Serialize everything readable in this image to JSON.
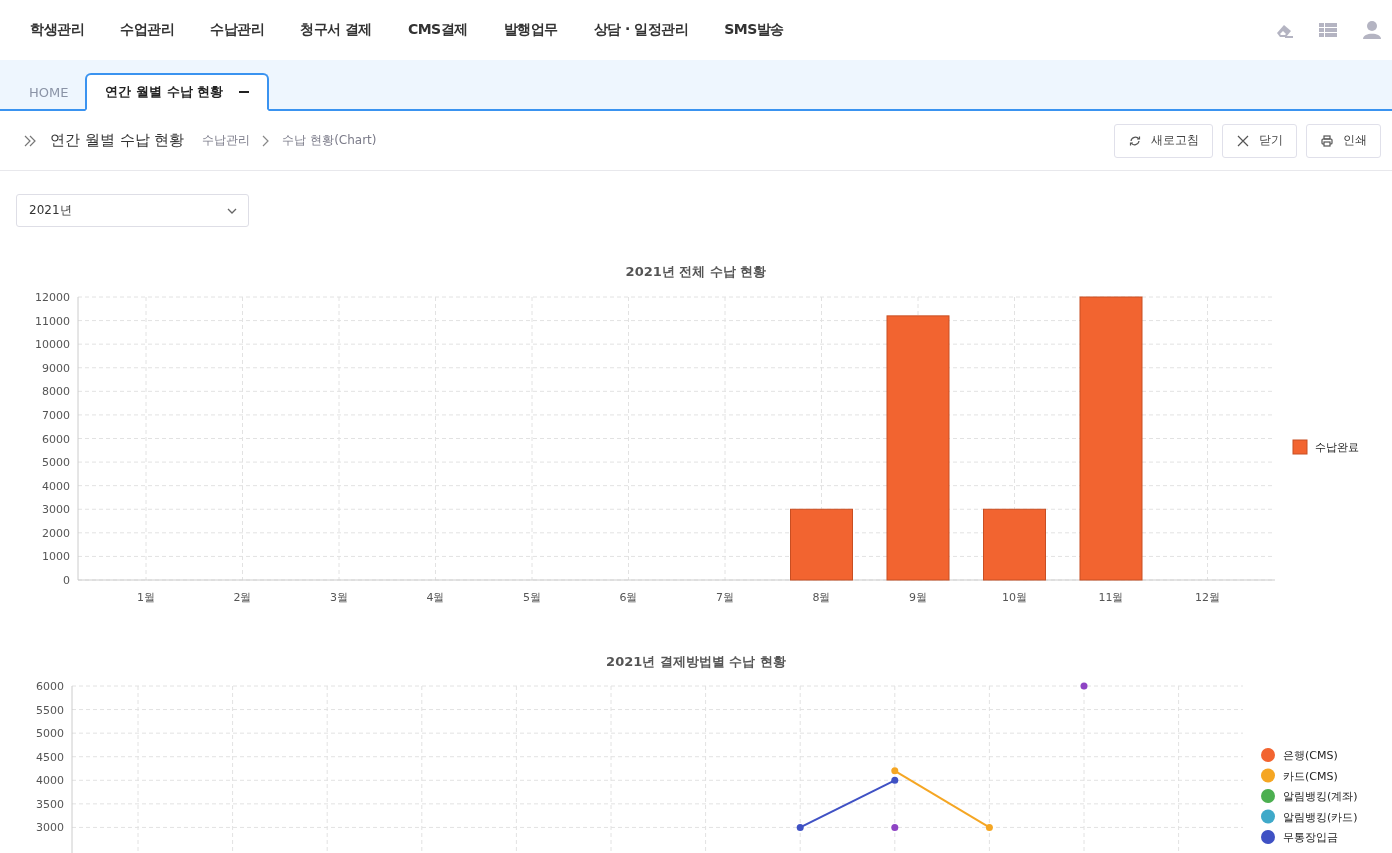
{
  "nav": {
    "menu": [
      "학생관리",
      "수업관리",
      "수납관리",
      "청구서 결제",
      "CMS결제",
      "발행업무",
      "상담 · 일정관리",
      "SMS발송"
    ]
  },
  "tabs": [
    {
      "label": "HOME",
      "selected": false,
      "closable": false
    },
    {
      "label": "연간 월별 수납 현황",
      "selected": true,
      "closable": true
    }
  ],
  "page_header": {
    "title": "연간 월별 수납 현황",
    "breadcrumb": [
      "수납관리",
      "수납 현황(Chart)"
    ],
    "buttons": [
      {
        "kind": "refresh",
        "label": "새로고침"
      },
      {
        "kind": "close",
        "label": "닫기"
      },
      {
        "kind": "print",
        "label": "인쇄"
      }
    ]
  },
  "year_select": {
    "value": "2021년"
  },
  "charts": [
    {
      "chart_data": {
        "type": "bar",
        "title": "2021년 전체 수납 현황",
        "categories": [
          "1월",
          "2월",
          "3월",
          "4월",
          "5월",
          "6월",
          "7월",
          "8월",
          "9월",
          "10월",
          "11월",
          "12월"
        ],
        "series": [
          {
            "name": "수납완료",
            "color": "#f26430",
            "values": [
              0,
              0,
              0,
              0,
              0,
              0,
              0,
              3000,
              11200,
              3000,
              12000,
              0
            ]
          }
        ],
        "ylim": [
          0,
          12000
        ],
        "grid": true,
        "legend": "right",
        "yticks": [
          0,
          1000,
          2000,
          3000,
          4000,
          5000,
          6000,
          7000,
          8000,
          9000,
          10000,
          11000,
          12000
        ]
      }
    },
    {
      "chart_data": {
        "type": "line",
        "title": "2021년 결제방법별 수납 현황",
        "series": [
          {
            "name": "은행(CMS)",
            "color": "#f26430",
            "marker": true,
            "values": [
              null,
              null,
              null,
              null,
              null,
              null,
              null,
              null,
              null,
              null,
              null,
              null
            ]
          },
          {
            "name": "카드(CMS)",
            "color": "#f5a623",
            "marker": true,
            "values": [
              null,
              null,
              null,
              null,
              null,
              null,
              null,
              null,
              4200,
              3000,
              null,
              null
            ]
          },
          {
            "name": "알림뱅킹(계좌)",
            "color": "#4caf50",
            "marker": true,
            "values": [
              null,
              null,
              null,
              null,
              null,
              null,
              null,
              null,
              null,
              null,
              null,
              null
            ]
          },
          {
            "name": "알림뱅킹(카드)",
            "color": "#3fa9c9",
            "marker": true,
            "values": [
              null,
              null,
              null,
              null,
              null,
              null,
              null,
              null,
              null,
              null,
              null,
              null
            ]
          },
          {
            "name": "무통장입금",
            "color": "#3f51c4",
            "marker": true,
            "values": [
              null,
              null,
              null,
              null,
              null,
              null,
              null,
              3000,
              4000,
              null,
              null,
              null
            ]
          },
          {
            "type": "scatter",
            "color": "#8e44c4",
            "values": [
              null,
              null,
              null,
              null,
              null,
              null,
              null,
              null,
              3000,
              null,
              6000,
              null
            ]
          }
        ],
        "ylim": [
          2500,
          6000
        ],
        "grid": true,
        "legend": "right",
        "yticks": [
          3000,
          3500,
          4000,
          4500,
          5000,
          5500,
          6000
        ]
      }
    }
  ]
}
